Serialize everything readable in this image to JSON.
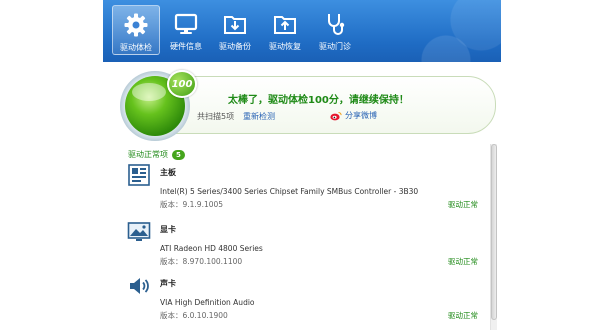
{
  "toolbar": {
    "items": [
      {
        "label": "驱动体检",
        "icon": "gear-icon",
        "active": true
      },
      {
        "label": "硬件信息",
        "icon": "monitor-icon"
      },
      {
        "label": "驱动备份",
        "icon": "backup-folder-icon"
      },
      {
        "label": "驱动恢复",
        "icon": "restore-folder-icon"
      },
      {
        "label": "驱动门诊",
        "icon": "stethoscope-icon"
      }
    ]
  },
  "summary": {
    "score_badge": "100",
    "headline": "太棒了，驱动体检100分，请继续保持！",
    "scan_info": "共扫描5项",
    "recheck": "重新检测",
    "share": "分享微博"
  },
  "section": {
    "title": "驱动正常项",
    "count": "5"
  },
  "devices": [
    {
      "icon": "motherboard-icon",
      "name": "主板",
      "description": "Intel(R) 5 Series/3400 Series Chipset Family SMBus Controller - 3B30",
      "version": "版本：9.1.9.1005",
      "status": "驱动正常"
    },
    {
      "icon": "display-icon",
      "name": "显卡",
      "description": "ATI Radeon HD 4800 Series",
      "version": "版本：8.970.100.1100",
      "status": "驱动正常"
    },
    {
      "icon": "speaker-icon",
      "name": "声卡",
      "description": "VIA High Definition Audio",
      "version": "版本：6.0.10.1900",
      "status": "驱动正常"
    }
  ],
  "colors": {
    "toolbar_blue": "#1f6cc4",
    "ok_green": "#1f8a17",
    "link_blue": "#2a64b5"
  }
}
